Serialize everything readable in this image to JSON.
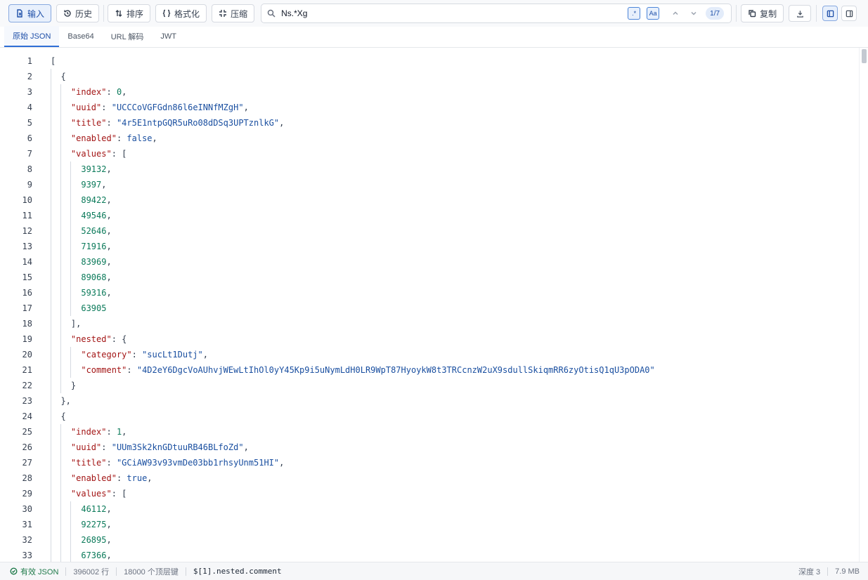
{
  "toolbar": {
    "input_label": "输入",
    "history_label": "历史",
    "sort_label": "排序",
    "format_label": "格式化",
    "compress_label": "压缩",
    "copy_label": "复制"
  },
  "search": {
    "value": "Ns.*Xg",
    "regex_label": ".*",
    "case_label": "Aa",
    "match_count": "1/7"
  },
  "tabs": [
    "原始 JSON",
    "Base64",
    "URL 解码",
    "JWT"
  ],
  "editor": {
    "lines": [
      [
        [
          "p",
          "["
        ]
      ],
      [
        [
          "p",
          "  {"
        ]
      ],
      [
        [
          "p",
          "    "
        ],
        [
          "k",
          "\"index\""
        ],
        [
          "p",
          ": "
        ],
        [
          "n",
          "0"
        ],
        [
          "p",
          ","
        ]
      ],
      [
        [
          "p",
          "    "
        ],
        [
          "k",
          "\"uuid\""
        ],
        [
          "p",
          ": "
        ],
        [
          "s",
          "\"UCCCoVGFGdn86l6eINNfMZgH\""
        ],
        [
          "p",
          ","
        ]
      ],
      [
        [
          "p",
          "    "
        ],
        [
          "k",
          "\"title\""
        ],
        [
          "p",
          ": "
        ],
        [
          "s",
          "\"4r5E1ntpGQR5uRo08dDSq3UPTznlkG\""
        ],
        [
          "p",
          ","
        ]
      ],
      [
        [
          "p",
          "    "
        ],
        [
          "k",
          "\"enabled\""
        ],
        [
          "p",
          ": "
        ],
        [
          "b",
          "false"
        ],
        [
          "p",
          ","
        ]
      ],
      [
        [
          "p",
          "    "
        ],
        [
          "k",
          "\"values\""
        ],
        [
          "p",
          ": ["
        ]
      ],
      [
        [
          "p",
          "      "
        ],
        [
          "n",
          "39132"
        ],
        [
          "p",
          ","
        ]
      ],
      [
        [
          "p",
          "      "
        ],
        [
          "n",
          "9397"
        ],
        [
          "p",
          ","
        ]
      ],
      [
        [
          "p",
          "      "
        ],
        [
          "n",
          "89422"
        ],
        [
          "p",
          ","
        ]
      ],
      [
        [
          "p",
          "      "
        ],
        [
          "n",
          "49546"
        ],
        [
          "p",
          ","
        ]
      ],
      [
        [
          "p",
          "      "
        ],
        [
          "n",
          "52646"
        ],
        [
          "p",
          ","
        ]
      ],
      [
        [
          "p",
          "      "
        ],
        [
          "n",
          "71916"
        ],
        [
          "p",
          ","
        ]
      ],
      [
        [
          "p",
          "      "
        ],
        [
          "n",
          "83969"
        ],
        [
          "p",
          ","
        ]
      ],
      [
        [
          "p",
          "      "
        ],
        [
          "n",
          "89068"
        ],
        [
          "p",
          ","
        ]
      ],
      [
        [
          "p",
          "      "
        ],
        [
          "n",
          "59316"
        ],
        [
          "p",
          ","
        ]
      ],
      [
        [
          "p",
          "      "
        ],
        [
          "n",
          "63905"
        ]
      ],
      [
        [
          "p",
          "    ],"
        ]
      ],
      [
        [
          "p",
          "    "
        ],
        [
          "k",
          "\"nested\""
        ],
        [
          "p",
          ": {"
        ]
      ],
      [
        [
          "p",
          "      "
        ],
        [
          "k",
          "\"category\""
        ],
        [
          "p",
          ": "
        ],
        [
          "s",
          "\"sucLt1Dutj\""
        ],
        [
          "p",
          ","
        ]
      ],
      [
        [
          "p",
          "      "
        ],
        [
          "k",
          "\"comment\""
        ],
        [
          "p",
          ": "
        ],
        [
          "s",
          "\"4D2eY6DgcVoAUhvjWEwLtIhOl0yY45Kp9i5uNymLdH0LR9WpT87HyoykW8t3TRCcnzW2uX9sdullSkiqmRR6zyOtisQ1qU3pODA0\""
        ]
      ],
      [
        [
          "p",
          "    }"
        ]
      ],
      [
        [
          "p",
          "  },"
        ]
      ],
      [
        [
          "p",
          "  {"
        ]
      ],
      [
        [
          "p",
          "    "
        ],
        [
          "k",
          "\"index\""
        ],
        [
          "p",
          ": "
        ],
        [
          "n",
          "1"
        ],
        [
          "p",
          ","
        ]
      ],
      [
        [
          "p",
          "    "
        ],
        [
          "k",
          "\"uuid\""
        ],
        [
          "p",
          ": "
        ],
        [
          "s",
          "\"UUm3Sk2knGDtuuRB46BLfoZd\""
        ],
        [
          "p",
          ","
        ]
      ],
      [
        [
          "p",
          "    "
        ],
        [
          "k",
          "\"title\""
        ],
        [
          "p",
          ": "
        ],
        [
          "s",
          "\"GCiAW93v93vmDe03bb1rhsyUnm51HI\""
        ],
        [
          "p",
          ","
        ]
      ],
      [
        [
          "p",
          "    "
        ],
        [
          "k",
          "\"enabled\""
        ],
        [
          "p",
          ": "
        ],
        [
          "b",
          "true"
        ],
        [
          "p",
          ","
        ]
      ],
      [
        [
          "p",
          "    "
        ],
        [
          "k",
          "\"values\""
        ],
        [
          "p",
          ": ["
        ]
      ],
      [
        [
          "p",
          "      "
        ],
        [
          "n",
          "46112"
        ],
        [
          "p",
          ","
        ]
      ],
      [
        [
          "p",
          "      "
        ],
        [
          "n",
          "92275"
        ],
        [
          "p",
          ","
        ]
      ],
      [
        [
          "p",
          "      "
        ],
        [
          "n",
          "26895"
        ],
        [
          "p",
          ","
        ]
      ],
      [
        [
          "p",
          "      "
        ],
        [
          "n",
          "67366"
        ],
        [
          "p",
          ","
        ]
      ]
    ]
  },
  "status": {
    "valid_label": "有效 JSON",
    "lines": "396002 行",
    "top_keys": "18000 个顶层键",
    "path": "$[1].nested.comment",
    "depth": "深度 3",
    "size": "7.9 MB"
  },
  "colors": {
    "accent": "#2f6fd6",
    "json_key": "#a31515",
    "json_string": "#1a4fa0",
    "json_number": "#0b7a5a",
    "valid_green": "#1f7a4a"
  }
}
